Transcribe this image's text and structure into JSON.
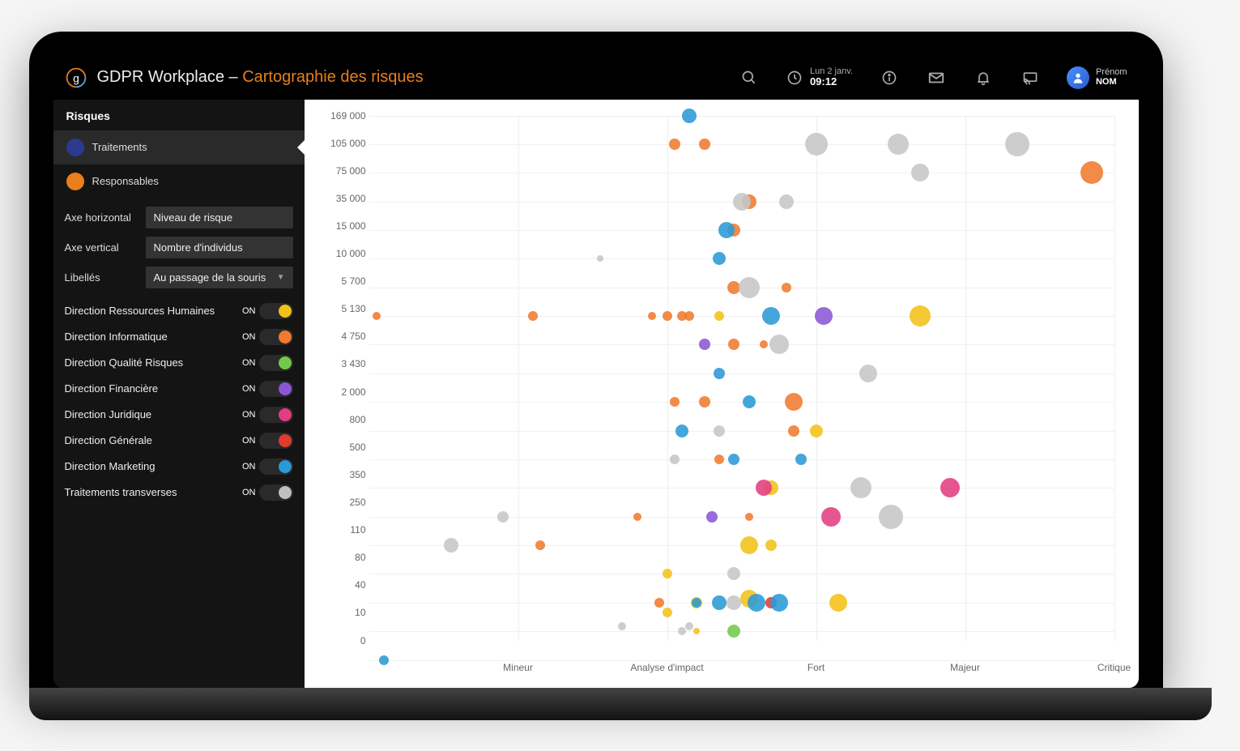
{
  "header": {
    "app_name": "GDPR Workplace",
    "separator": "–",
    "page_title": "Cartographie des risques",
    "date_label": "Lun 2 janv.",
    "time_label": "09:12",
    "first_name": "Prénom",
    "last_name": "NOM"
  },
  "sidebar": {
    "section_title": "Risques",
    "nav": [
      {
        "label": "Traitements",
        "active": true,
        "icon_bg": "#2a3b8f"
      },
      {
        "label": "Responsables",
        "active": false,
        "icon_bg": "#e97e1b"
      }
    ],
    "axis_controls": [
      {
        "label": "Axe horizontal",
        "value": "Niveau de risque",
        "chevron": false
      },
      {
        "label": "Axe vertical",
        "value": "Nombre d'individus",
        "chevron": false
      },
      {
        "label": "Libellés",
        "value": "Au passage de la souris",
        "chevron": true
      }
    ],
    "toggles": [
      {
        "label": "Direction Ressources Humaines",
        "state": "ON",
        "color": "#f3c218"
      },
      {
        "label": "Direction Informatique",
        "state": "ON",
        "color": "#f07a2f"
      },
      {
        "label": "Direction Qualité Risques",
        "state": "ON",
        "color": "#73c94a"
      },
      {
        "label": "Direction Financière",
        "state": "ON",
        "color": "#8b56d6"
      },
      {
        "label": "Direction Juridique",
        "state": "ON",
        "color": "#e23d82"
      },
      {
        "label": "Direction Générale",
        "state": "ON",
        "color": "#e23b2e"
      },
      {
        "label": "Direction Marketing",
        "state": "ON",
        "color": "#2a9ad6"
      },
      {
        "label": "Traitements transverses",
        "state": "ON",
        "color": "#bfbfbf"
      }
    ]
  },
  "colors": {
    "yellow": "#f3c218",
    "orange": "#f07a2f",
    "green": "#73c94a",
    "purple": "#8b56d6",
    "pink": "#e23d82",
    "red": "#e23b2e",
    "blue": "#2a9ad6",
    "grey": "#c6c6c6"
  },
  "chart_data": {
    "type": "scatter",
    "title": "",
    "xlabel": "Niveau de risque",
    "ylabel": "Nombre d'individus",
    "x_categories": [
      "Mineur",
      "Analyse d'impact",
      "Fort",
      "Majeur",
      "Critique"
    ],
    "x_numeric_range": [
      0,
      5
    ],
    "y_ticks": [
      0,
      10,
      40,
      80,
      110,
      250,
      350,
      500,
      800,
      2000,
      3430,
      4750,
      5130,
      5700,
      10000,
      15000,
      35000,
      75000,
      105000,
      169000
    ],
    "yscale": "log-like (ordinal ticks)",
    "legend": [
      "Direction Ressources Humaines",
      "Direction Informatique",
      "Direction Qualité Risques",
      "Direction Financière",
      "Direction Juridique",
      "Direction Générale",
      "Direction Marketing",
      "Traitements transverses"
    ],
    "series": [
      {
        "name": "Direction Ressources Humaines",
        "color": "yellow",
        "points": [
          {
            "x": 2.0,
            "y": 30,
            "size": 12
          },
          {
            "x": 2.2,
            "y": 40,
            "size": 14
          },
          {
            "x": 2.2,
            "y": 10,
            "size": 8
          },
          {
            "x": 2.0,
            "y": 80,
            "size": 12
          },
          {
            "x": 2.55,
            "y": 110,
            "size": 22
          },
          {
            "x": 2.7,
            "y": 110,
            "size": 14
          },
          {
            "x": 2.7,
            "y": 350,
            "size": 18
          },
          {
            "x": 2.55,
            "y": 45,
            "size": 22
          },
          {
            "x": 3.0,
            "y": 800,
            "size": 16
          },
          {
            "x": 3.15,
            "y": 40,
            "size": 22
          },
          {
            "x": 3.7,
            "y": 5130,
            "size": 26
          },
          {
            "x": 2.35,
            "y": 5130,
            "size": 12
          }
        ]
      },
      {
        "name": "Direction Informatique",
        "color": "orange",
        "points": [
          {
            "x": 0.05,
            "y": 5130,
            "size": 10
          },
          {
            "x": 1.1,
            "y": 5130,
            "size": 12
          },
          {
            "x": 1.9,
            "y": 5130,
            "size": 10
          },
          {
            "x": 2.0,
            "y": 5130,
            "size": 12
          },
          {
            "x": 2.1,
            "y": 5130,
            "size": 12
          },
          {
            "x": 2.15,
            "y": 5130,
            "size": 12
          },
          {
            "x": 2.45,
            "y": 4750,
            "size": 14
          },
          {
            "x": 2.45,
            "y": 5700,
            "size": 16
          },
          {
            "x": 2.65,
            "y": 4750,
            "size": 10
          },
          {
            "x": 2.8,
            "y": 5700,
            "size": 12
          },
          {
            "x": 2.45,
            "y": 15000,
            "size": 16
          },
          {
            "x": 2.05,
            "y": 105000,
            "size": 14
          },
          {
            "x": 2.25,
            "y": 105000,
            "size": 14
          },
          {
            "x": 2.55,
            "y": 250,
            "size": 10
          },
          {
            "x": 1.15,
            "y": 110,
            "size": 12
          },
          {
            "x": 1.8,
            "y": 250,
            "size": 10
          },
          {
            "x": 1.95,
            "y": 40,
            "size": 12
          },
          {
            "x": 2.35,
            "y": 500,
            "size": 12
          },
          {
            "x": 2.05,
            "y": 2000,
            "size": 12
          },
          {
            "x": 2.25,
            "y": 2000,
            "size": 14
          },
          {
            "x": 2.85,
            "y": 2000,
            "size": 22
          },
          {
            "x": 2.85,
            "y": 800,
            "size": 14
          },
          {
            "x": 2.55,
            "y": 35000,
            "size": 18
          },
          {
            "x": 4.85,
            "y": 75000,
            "size": 28
          }
        ]
      },
      {
        "name": "Direction Qualité Risques",
        "color": "green",
        "points": [
          {
            "x": 2.45,
            "y": 10,
            "size": 16
          }
        ]
      },
      {
        "name": "Direction Financière",
        "color": "purple",
        "points": [
          {
            "x": 2.25,
            "y": 4750,
            "size": 14
          },
          {
            "x": 2.3,
            "y": 250,
            "size": 14
          },
          {
            "x": 3.05,
            "y": 5130,
            "size": 22
          }
        ]
      },
      {
        "name": "Direction Juridique",
        "color": "pink",
        "points": [
          {
            "x": 2.65,
            "y": 350,
            "size": 20
          },
          {
            "x": 3.1,
            "y": 250,
            "size": 24
          },
          {
            "x": 3.9,
            "y": 350,
            "size": 24
          }
        ]
      },
      {
        "name": "Direction Générale",
        "color": "red",
        "points": [
          {
            "x": 2.7,
            "y": 40,
            "size": 14
          }
        ]
      },
      {
        "name": "Direction Marketing",
        "color": "blue",
        "points": [
          {
            "x": 0.1,
            "y": 0,
            "size": 12
          },
          {
            "x": 2.15,
            "y": 169000,
            "size": 18
          },
          {
            "x": 2.4,
            "y": 15000,
            "size": 20
          },
          {
            "x": 2.7,
            "y": 5130,
            "size": 22
          },
          {
            "x": 2.1,
            "y": 800,
            "size": 16
          },
          {
            "x": 2.45,
            "y": 500,
            "size": 14
          },
          {
            "x": 2.35,
            "y": 3430,
            "size": 14
          },
          {
            "x": 2.35,
            "y": 10000,
            "size": 16
          },
          {
            "x": 2.6,
            "y": 40,
            "size": 22
          },
          {
            "x": 2.75,
            "y": 40,
            "size": 22
          },
          {
            "x": 2.2,
            "y": 40,
            "size": 12
          },
          {
            "x": 2.55,
            "y": 2000,
            "size": 16
          },
          {
            "x": 2.9,
            "y": 500,
            "size": 14
          },
          {
            "x": 2.35,
            "y": 40,
            "size": 18
          }
        ]
      },
      {
        "name": "Traitements transverses",
        "color": "grey",
        "points": [
          {
            "x": 0.9,
            "y": 250,
            "size": 14
          },
          {
            "x": 1.7,
            "y": 15,
            "size": 10
          },
          {
            "x": 1.55,
            "y": 10000,
            "size": 8
          },
          {
            "x": 2.15,
            "y": 15,
            "size": 10
          },
          {
            "x": 2.1,
            "y": 10,
            "size": 10
          },
          {
            "x": 0.55,
            "y": 110,
            "size": 18
          },
          {
            "x": 2.45,
            "y": 80,
            "size": 16
          },
          {
            "x": 2.45,
            "y": 40,
            "size": 18
          },
          {
            "x": 2.05,
            "y": 500,
            "size": 12
          },
          {
            "x": 2.35,
            "y": 800,
            "size": 14
          },
          {
            "x": 2.55,
            "y": 5700,
            "size": 26
          },
          {
            "x": 2.75,
            "y": 4750,
            "size": 24
          },
          {
            "x": 2.5,
            "y": 35000,
            "size": 22
          },
          {
            "x": 2.8,
            "y": 35000,
            "size": 18
          },
          {
            "x": 3.0,
            "y": 105000,
            "size": 28
          },
          {
            "x": 3.55,
            "y": 105000,
            "size": 26
          },
          {
            "x": 4.35,
            "y": 105000,
            "size": 30
          },
          {
            "x": 3.3,
            "y": 350,
            "size": 26
          },
          {
            "x": 3.5,
            "y": 250,
            "size": 30
          },
          {
            "x": 3.35,
            "y": 3430,
            "size": 22
          },
          {
            "x": 3.7,
            "y": 75000,
            "size": 22
          }
        ]
      }
    ]
  }
}
